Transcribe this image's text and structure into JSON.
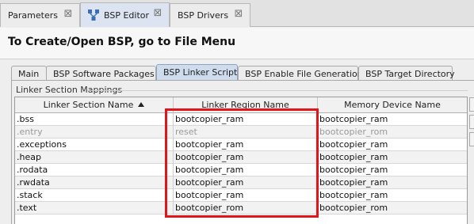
{
  "editor_tabs": [
    {
      "label": "Parameters"
    },
    {
      "label": "BSP Editor"
    },
    {
      "label": "BSP Drivers"
    }
  ],
  "header": {
    "title": "To Create/Open BSP, go to File Menu"
  },
  "inner_tabs": [
    {
      "label": "Main"
    },
    {
      "label": "BSP Software Packages"
    },
    {
      "label": "BSP Linker Script"
    },
    {
      "label": "BSP Enable File Generation"
    },
    {
      "label": "BSP Target Directory"
    }
  ],
  "section": {
    "label": "Linker Section Mappings"
  },
  "table": {
    "columns": [
      "Linker Section Name",
      "Linker Region Name",
      "Memory Device Name"
    ],
    "rows": [
      {
        "section": ".bss",
        "region": "bootcopier_ram",
        "device": "bootcopier_ram"
      },
      {
        "section": ".entry",
        "region": "reset",
        "device": "bootcopier_rom"
      },
      {
        "section": ".exceptions",
        "region": "bootcopier_ram",
        "device": "bootcopier_ram"
      },
      {
        "section": ".heap",
        "region": "bootcopier_ram",
        "device": "bootcopier_ram"
      },
      {
        "section": ".rodata",
        "region": "bootcopier_ram",
        "device": "bootcopier_ram"
      },
      {
        "section": ".rwdata",
        "region": "bootcopier_ram",
        "device": "bootcopier_ram"
      },
      {
        "section": ".stack",
        "region": "bootcopier_ram",
        "device": "bootcopier_ram"
      },
      {
        "section": ".text",
        "region": "bootcopier_rom",
        "device": "bootcopier_rom"
      }
    ]
  },
  "colors": {
    "highlight": "#e0161a",
    "active_tab": "#cfdced"
  },
  "icons": {
    "bsp_editor_tab": "bsp-editor-icon",
    "tab_close": "close-icon",
    "sort": "sort-ascending-icon"
  }
}
